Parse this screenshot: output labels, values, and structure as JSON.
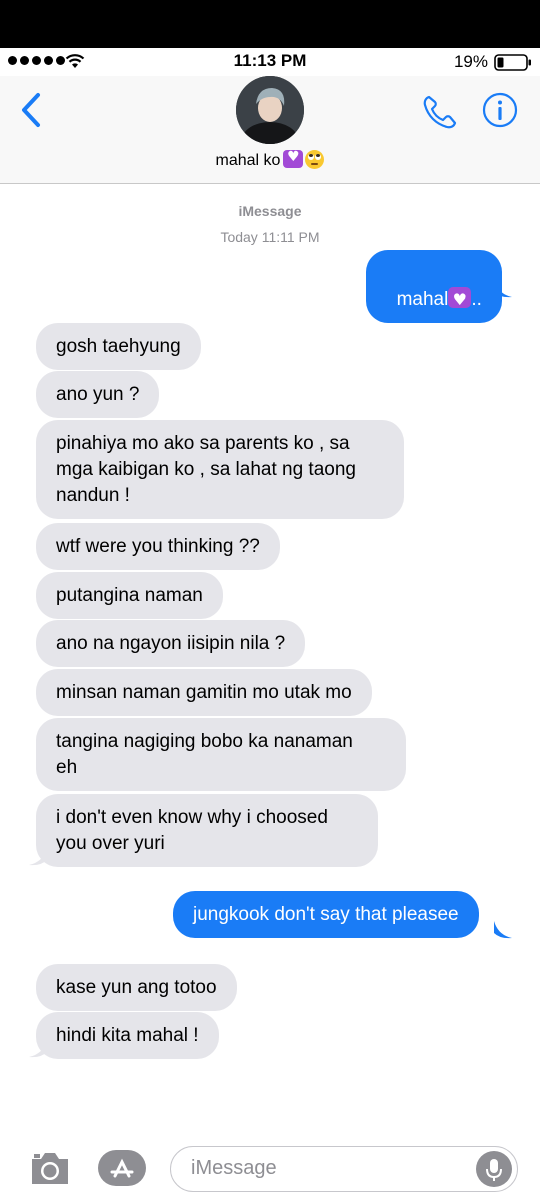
{
  "status_bar": {
    "time": "11:13 PM",
    "battery": "19%"
  },
  "header": {
    "contact_name": "mahal ko"
  },
  "thread": {
    "service": "iMessage",
    "timestamp": "Today 11:11 PM"
  },
  "messages": [
    {
      "from": "me",
      "text": "mahal",
      "suffix": ".."
    },
    {
      "from": "them",
      "text": "gosh taehyung"
    },
    {
      "from": "them",
      "text": "ano yun ?"
    },
    {
      "from": "them",
      "text": "pinahiya mo ako sa parents ko , sa\nmga kaibigan ko , sa lahat ng taong\nnandun !"
    },
    {
      "from": "them",
      "text": "wtf were you thinking ??"
    },
    {
      "from": "them",
      "text": "putangina naman"
    },
    {
      "from": "them",
      "text": "ano na ngayon iisipin nila ?"
    },
    {
      "from": "them",
      "text": "minsan naman gamitin mo utak mo"
    },
    {
      "from": "them",
      "text": "tangina nagiging bobo ka nanaman\neh"
    },
    {
      "from": "them",
      "text": "i don't even know why i choosed\nyou over yuri"
    },
    {
      "from": "me",
      "text": "jungkook don't say that pleasee"
    },
    {
      "from": "them",
      "text": "kase yun ang totoo"
    },
    {
      "from": "them",
      "text": "hindi kita mahal !"
    }
  ],
  "compose": {
    "placeholder": "iMessage"
  },
  "colors": {
    "accent": "#1a7cf6",
    "incoming_bubble": "#e5e5ea",
    "meta_text": "#8e8e93",
    "heart_emoji": "#a24ad6"
  },
  "icons": [
    "signal-dots-icon",
    "wifi-icon",
    "battery-icon",
    "back-chevron-icon",
    "phone-icon",
    "info-icon",
    "camera-icon",
    "app-store-icon",
    "microphone-icon"
  ]
}
